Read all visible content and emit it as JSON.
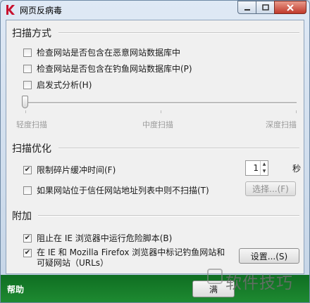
{
  "window": {
    "title": "网页反病毒"
  },
  "scan_method": {
    "title": "扫描方式",
    "options": [
      {
        "label": "检查网站是否包含在恶意网站数据库中",
        "checked": false
      },
      {
        "label": "检查网站是否包含在钓鱼网站数据库中(P)",
        "checked": false
      },
      {
        "label": "启发式分析(H)",
        "checked": false
      }
    ],
    "slider": {
      "labels": [
        "轻度扫描",
        "中度扫描",
        "深度扫描"
      ],
      "level": 0
    }
  },
  "scan_optimization": {
    "title": "扫描优化",
    "limit_buffer": {
      "label": "限制碎片缓冲时间(F)",
      "checked": true
    },
    "buffer_value": "1",
    "buffer_unit": "秒",
    "trusted": {
      "label": "如果网站位于信任网站地址列表中则不扫描(T)",
      "checked": false
    },
    "select_button": "选择...(F)"
  },
  "additional": {
    "title": "附加",
    "block_ie": {
      "label": "阻止在 IE 浏览器中运行危险脚本(B)",
      "checked": true
    },
    "mark_links": {
      "label_line1": "在 IE 和 Mozilla Firefox 浏览器中标记钓鱼网站和",
      "label_line2": "可疑网站（URLs）",
      "checked": true
    },
    "settings_button": "设置...(S)"
  },
  "footer": {
    "help": "帮助",
    "ok_partial": "满"
  },
  "watermark": {
    "text": "软件技巧"
  },
  "colors": {
    "footer": "#1e8a31",
    "close": "#c0392b"
  }
}
